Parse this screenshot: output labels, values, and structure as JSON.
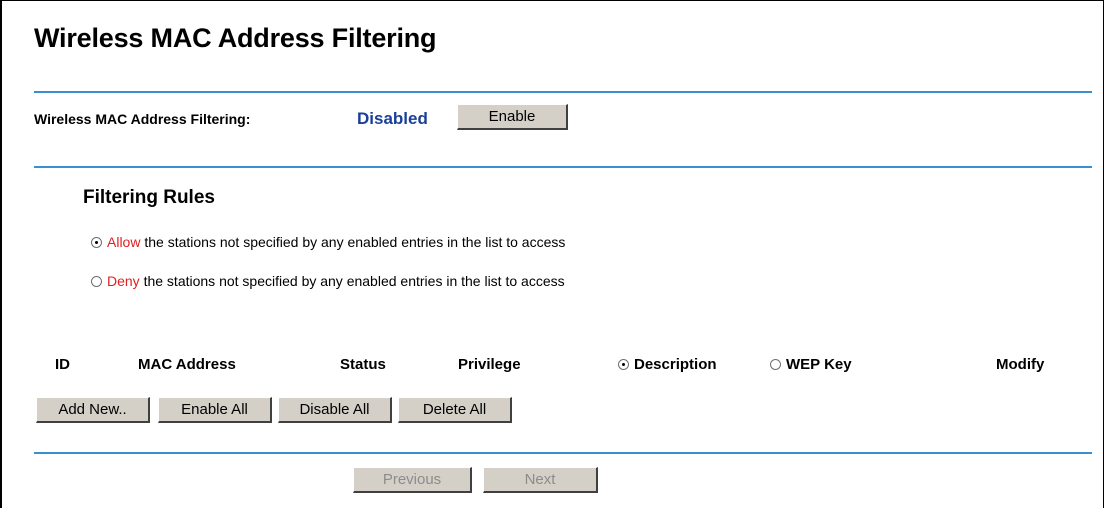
{
  "page": {
    "title": "Wireless MAC Address Filtering"
  },
  "filtering": {
    "label": "Wireless MAC Address Filtering:",
    "status": "Disabled",
    "enable_button": "Enable"
  },
  "rules": {
    "title": "Filtering Rules",
    "options": [
      {
        "keyword": "Allow",
        "text": " the stations not specified by any enabled entries in the list to access",
        "selected": true
      },
      {
        "keyword": "Deny",
        "text": " the stations not specified by any enabled entries in the list to access",
        "selected": false
      }
    ]
  },
  "table": {
    "columns": {
      "id": "ID",
      "mac": "MAC Address",
      "status": "Status",
      "privilege": "Privilege",
      "description": "Description",
      "wep_key": "WEP Key",
      "modify": "Modify"
    },
    "display_mode": "Description"
  },
  "actions": {
    "add_new": "Add New..",
    "enable_all": "Enable All",
    "disable_all": "Disable All",
    "delete_all": "Delete All"
  },
  "pagination": {
    "previous": "Previous",
    "next": "Next"
  },
  "colors": {
    "rule_line": "#3a8fce",
    "status_text": "#1a3f99",
    "keyword_red": "#e02020",
    "button_face": "#d4d0c8",
    "disabled_text": "#8c8c8c"
  }
}
